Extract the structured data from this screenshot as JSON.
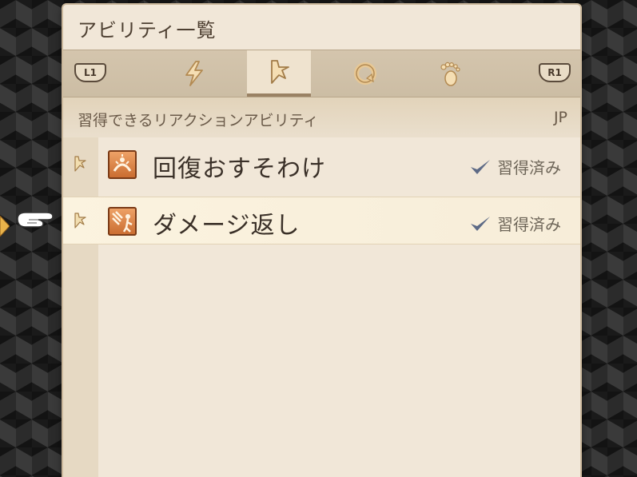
{
  "panel": {
    "title": "アビリティ一覧",
    "tabs": [
      {
        "name": "action",
        "icon": "lightning-icon",
        "active": false
      },
      {
        "name": "reaction",
        "icon": "reaction-lightning-icon",
        "active": true
      },
      {
        "name": "support",
        "icon": "cycle-icon",
        "active": false
      },
      {
        "name": "movement",
        "icon": "footprint-icon",
        "active": false
      }
    ],
    "shoulder_left": "L1",
    "shoulder_right": "R1",
    "header": {
      "label": "習得できるリアクションアビリティ",
      "jp_label": "JP"
    },
    "abilities": [
      {
        "name": "回復おすそわけ",
        "status": "習得済み",
        "icon": "heal-share-icon"
      },
      {
        "name": "ダメージ返し",
        "status": "習得済み",
        "icon": "counter-damage-icon"
      }
    ]
  },
  "colors": {
    "panel_bg": "#f1e7d8",
    "accent": "#c86a2e",
    "check": "#5d6a86"
  }
}
